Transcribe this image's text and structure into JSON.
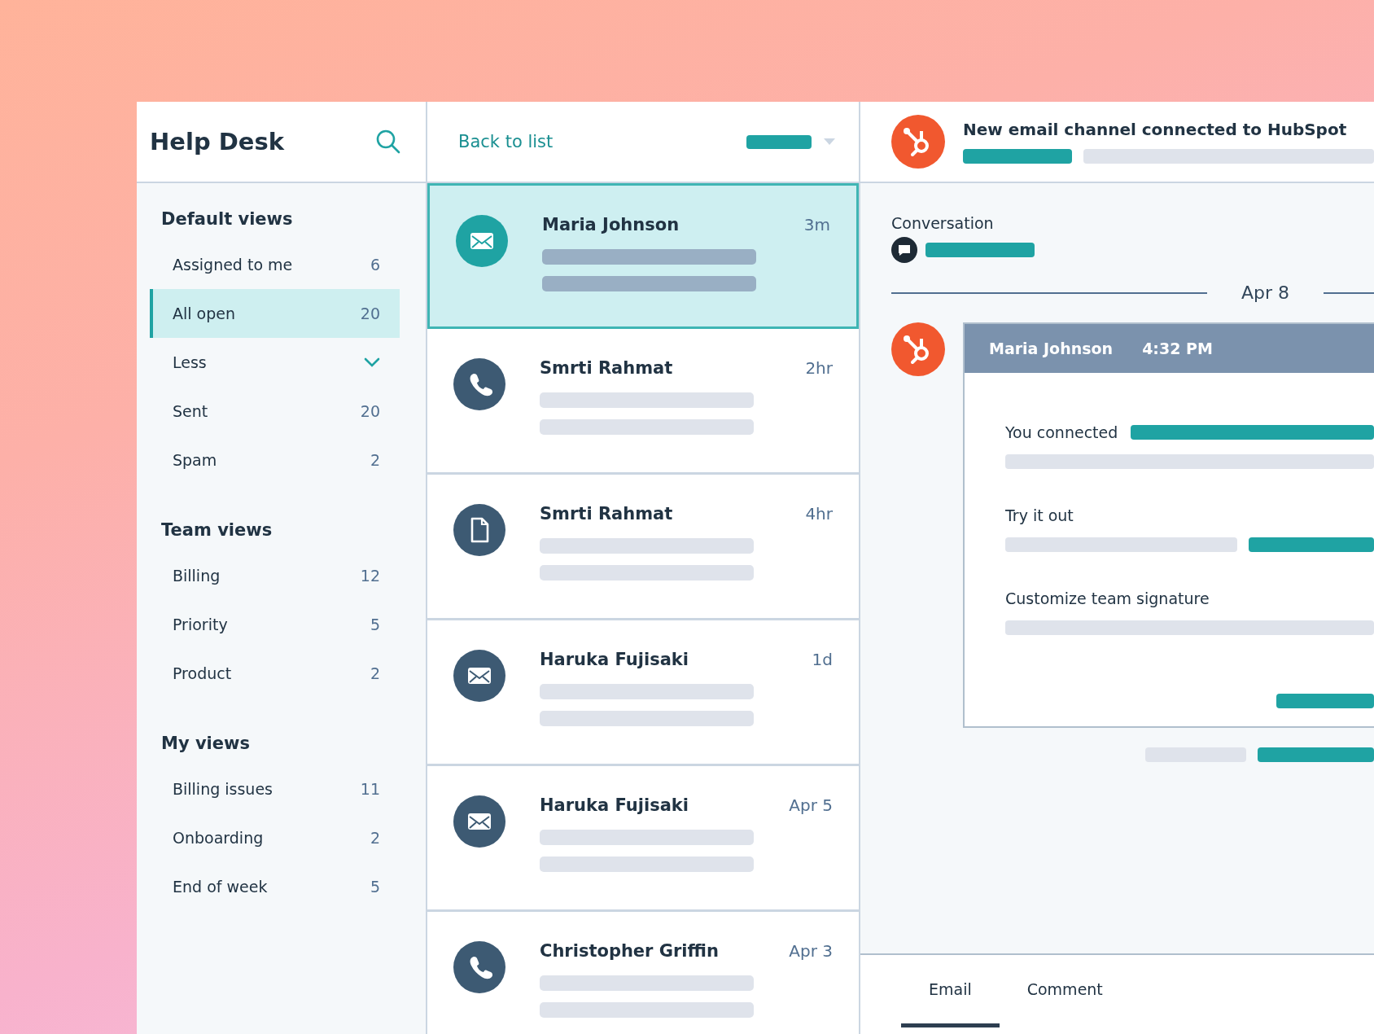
{
  "sidebar": {
    "title": "Help Desk",
    "sections": [
      {
        "heading": "Default views",
        "items": [
          {
            "kind": "view",
            "label": "Assigned to me",
            "count": "6",
            "selected": false
          },
          {
            "kind": "view",
            "label": "All open",
            "count": "20",
            "selected": true
          },
          {
            "kind": "toggle",
            "label": "Less",
            "selected": false
          },
          {
            "kind": "view",
            "label": "Sent",
            "count": "20",
            "selected": false
          },
          {
            "kind": "view",
            "label": "Spam",
            "count": "2",
            "selected": false
          }
        ]
      },
      {
        "heading": "Team views",
        "items": [
          {
            "kind": "view",
            "label": "Billing",
            "count": "12",
            "selected": false
          },
          {
            "kind": "view",
            "label": "Priority",
            "count": "5",
            "selected": false
          },
          {
            "kind": "view",
            "label": "Product",
            "count": "2",
            "selected": false
          }
        ]
      },
      {
        "heading": "My views",
        "items": [
          {
            "kind": "view",
            "label": "Billing issues",
            "count": "11",
            "selected": false
          },
          {
            "kind": "view",
            "label": "Onboarding",
            "count": "2",
            "selected": false
          },
          {
            "kind": "view",
            "label": "End of week",
            "count": "5",
            "selected": false
          }
        ]
      }
    ]
  },
  "list": {
    "back_link": "Back to list",
    "conversations": [
      {
        "kind": "email",
        "name": "Maria Johnson",
        "time": "3m",
        "selected": true
      },
      {
        "kind": "phone",
        "name": "Smrti Rahmat",
        "time": "2hr",
        "selected": false
      },
      {
        "kind": "file",
        "name": "Smrti Rahmat",
        "time": "4hr",
        "selected": false
      },
      {
        "kind": "email",
        "name": "Haruka Fujisaki",
        "time": "1d",
        "selected": false
      },
      {
        "kind": "email",
        "name": "Haruka Fujisaki",
        "time": "Apr 5",
        "selected": false
      },
      {
        "kind": "phone",
        "name": "Christopher Griffin",
        "time": "Apr 3",
        "selected": false
      }
    ]
  },
  "detail": {
    "title": "New email channel connected to HubSpot",
    "section_label": "Conversation",
    "date": "Apr 8",
    "message": {
      "sender": "Maria Johnson",
      "time": "4:32 PM",
      "lines": [
        "You connected",
        "Try it out",
        "Customize team signature"
      ]
    },
    "composer_tabs": [
      {
        "label": "Email",
        "selected": true
      },
      {
        "label": "Comment",
        "selected": false
      }
    ]
  }
}
